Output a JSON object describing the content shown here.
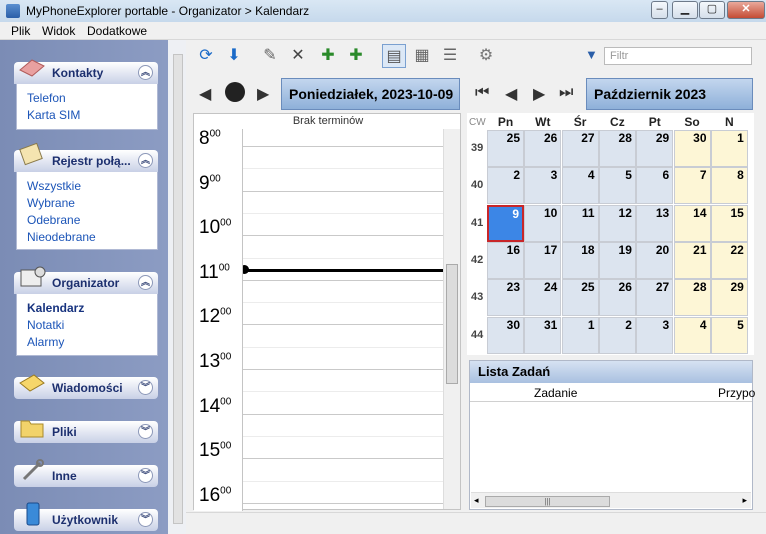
{
  "window": {
    "title": "MyPhoneExplorer portable -  Organizator > Kalendarz"
  },
  "menu": {
    "items": [
      "Plik",
      "Widok",
      "Dodatkowe"
    ]
  },
  "sidebar": {
    "sections": [
      {
        "title": "Kontakty",
        "items": [
          "Telefon",
          "Karta SIM"
        ]
      },
      {
        "title": "Rejestr połą...",
        "items": [
          "Wszystkie",
          "Wybrane",
          "Odebrane",
          "Nieodebrane"
        ]
      },
      {
        "title": "Organizator",
        "items": [
          "Kalendarz",
          "Notatki",
          "Alarmy"
        ]
      },
      {
        "title": "Wiadomości",
        "items": []
      },
      {
        "title": "Pliki",
        "items": []
      },
      {
        "title": "Inne",
        "items": []
      },
      {
        "title": "Użytkownik",
        "items": []
      }
    ]
  },
  "toolbar": {
    "icons": [
      "refresh-icon",
      "download-icon",
      "edit-icon",
      "delete-icon",
      "add-entry-icon",
      "add-task-icon",
      "day-view-icon",
      "week-view-icon",
      "list-view-icon",
      "sync-icon"
    ],
    "filter_placeholder": "Filtr"
  },
  "day": {
    "date": "Poniedziałek, 2023-10-09",
    "no_meetings": "Brak terminów",
    "hours": [
      "8",
      "9",
      "10",
      "11",
      "12",
      "13",
      "14",
      "15",
      "16"
    ],
    "minutes": "00"
  },
  "month": {
    "title": "Październik 2023",
    "cw_label": "CW",
    "weekdays": [
      "Pn",
      "Wt",
      "Śr",
      "Cz",
      "Pt",
      "So",
      "N"
    ],
    "weeks": [
      {
        "cw": "39",
        "days": [
          "25",
          "26",
          "27",
          "28",
          "29",
          "30",
          "1"
        ]
      },
      {
        "cw": "40",
        "days": [
          "2",
          "3",
          "4",
          "5",
          "6",
          "7",
          "8"
        ]
      },
      {
        "cw": "41",
        "days": [
          "9",
          "10",
          "11",
          "12",
          "13",
          "14",
          "15"
        ]
      },
      {
        "cw": "42",
        "days": [
          "16",
          "17",
          "18",
          "19",
          "20",
          "21",
          "22"
        ]
      },
      {
        "cw": "43",
        "days": [
          "23",
          "24",
          "25",
          "26",
          "27",
          "28",
          "29"
        ]
      },
      {
        "cw": "44",
        "days": [
          "30",
          "31",
          "1",
          "2",
          "3",
          "4",
          "5"
        ]
      }
    ],
    "selected_day": "9"
  },
  "tasks": {
    "title": "Lista Zadań",
    "columns": [
      "Zadanie",
      "Przypo"
    ]
  },
  "colors": {
    "accent": "#3c86e6",
    "selection_border": "#c8262a",
    "sidebar": "#8c9cc3"
  }
}
